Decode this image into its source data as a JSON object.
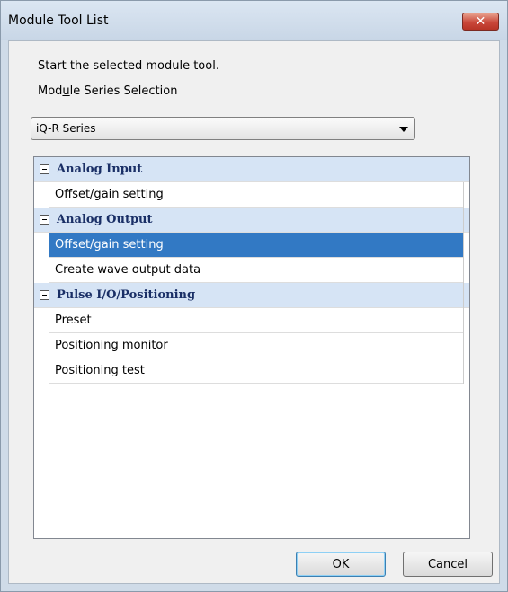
{
  "window": {
    "title": "Module Tool List",
    "close_glyph": "✕"
  },
  "intro": {
    "line1": "Start the selected module tool.",
    "line2_pre": "Mod",
    "line2_accel": "u",
    "line2_post": "le Series Selection"
  },
  "series_select": {
    "value": "iQ-R Series"
  },
  "categories": [
    {
      "label": "Analog Input",
      "items": [
        "Offset/gain setting"
      ]
    },
    {
      "label": "Analog Output",
      "items": [
        "Offset/gain setting",
        "Create wave output data"
      ],
      "selected_item": "Offset/gain setting"
    },
    {
      "label": "Pulse I/O/Positioning",
      "items": [
        "Preset",
        "Positioning monitor",
        "Positioning test"
      ]
    }
  ],
  "buttons": {
    "ok": "OK",
    "cancel": "Cancel"
  },
  "colors": {
    "selection": "#3279c4",
    "category_bg": "#d6e4f5",
    "close_button": "#c9473a"
  }
}
